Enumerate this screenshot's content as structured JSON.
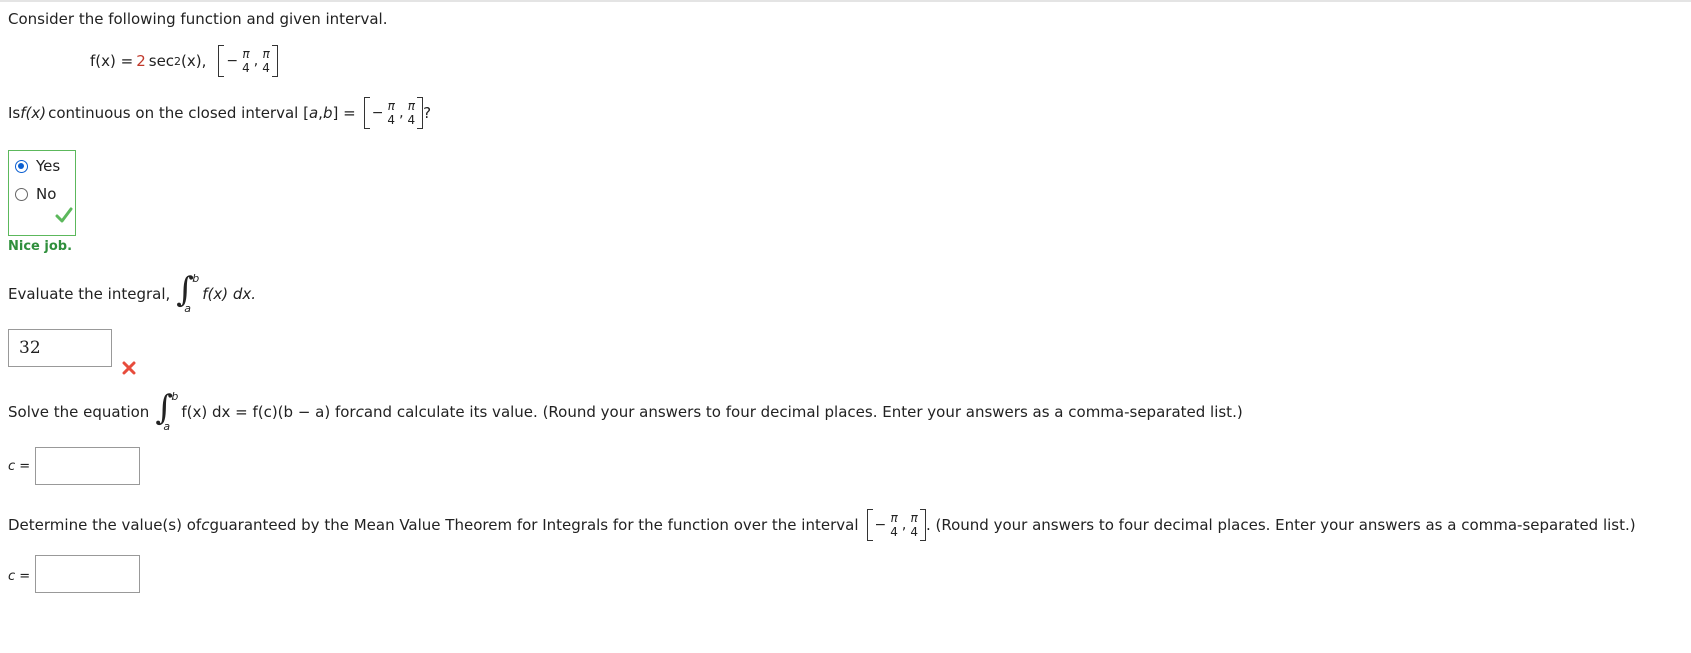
{
  "intro": "Consider the following function and given interval.",
  "function": {
    "lhs": "f(x) = ",
    "coef": "2",
    "body": " sec",
    "exp": "2",
    "arg": "(x),",
    "pi": "π",
    "den": "4",
    "minus": "−",
    "comma": ","
  },
  "q1": {
    "text_pre": "Is ",
    "fx": "f(x)",
    "text_mid": " continuous on the closed interval [",
    "a": "a",
    "sep": ", ",
    "b": "b",
    "text_end": "] =",
    "qmark": "?"
  },
  "radio": {
    "options": [
      {
        "label": "Yes",
        "selected": true
      },
      {
        "label": "No",
        "selected": false
      }
    ],
    "status": "correct"
  },
  "feedback": "Nice job.",
  "q2": {
    "text": "Evaluate the integral,",
    "upper": "b",
    "lower": "a",
    "integrand": "f(x) dx.",
    "answer": "32",
    "status": "incorrect"
  },
  "q3": {
    "text_pre": "Solve the equation",
    "upper": "b",
    "lower": "a",
    "integrand": "f(x) dx = f(c)(b − a) for ",
    "c": "c",
    "text_end": " and calculate its value. (Round your answers to four decimal places. Enter your answers as a comma-separated list.)",
    "label": "c =",
    "value": ""
  },
  "q4": {
    "text_pre": "Determine the value(s) of ",
    "c": "c",
    "text_mid": " guaranteed by the Mean Value Theorem for Integrals for the function over the interval",
    "text_end": ". (Round your answers to four decimal places. Enter your answers as a comma-separated list.)",
    "label": "c =",
    "value": ""
  },
  "icons": {
    "check": "check-icon",
    "cross": "cross-icon"
  },
  "colors": {
    "correct": "#5cb85c",
    "incorrect": "#e74c3c",
    "accent": "#0b5fd1",
    "coef": "#c0392b"
  }
}
